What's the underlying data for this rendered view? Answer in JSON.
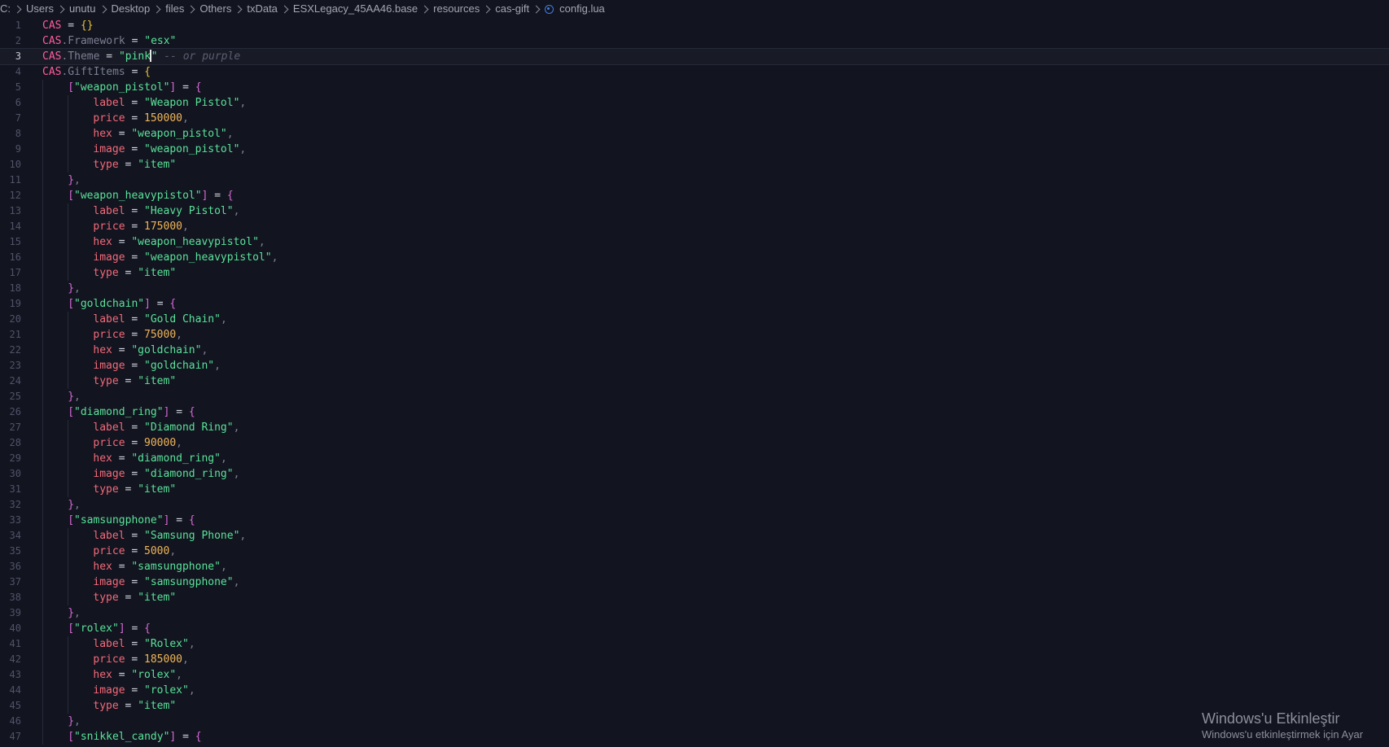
{
  "breadcrumb": {
    "segments": [
      "C:",
      "Users",
      "unutu",
      "Desktop",
      "files",
      "Others",
      "txData",
      "ESXLegacy_45AA46.base",
      "resources",
      "cas-gift"
    ],
    "file": "config.lua",
    "file_icon": "lua-file-icon"
  },
  "editor": {
    "current_line": 3,
    "colors": {
      "background": "#12141f",
      "keyword": "#ff5c9c",
      "string": "#59e39a",
      "number": "#f0b657",
      "field": "#f46a7a",
      "comment": "#5b5e72"
    },
    "lines": [
      {
        "n": "1",
        "indent": 0,
        "tokens": [
          [
            "kw-pink",
            "CAS"
          ],
          [
            "op",
            " = "
          ],
          [
            "brace",
            "{}"
          ]
        ]
      },
      {
        "n": "2",
        "indent": 0,
        "tokens": [
          [
            "kw-pink",
            "CAS"
          ],
          [
            "kw-prop",
            ".Framework"
          ],
          [
            "op",
            " = "
          ],
          [
            "str",
            "\"esx\""
          ]
        ]
      },
      {
        "n": "3",
        "indent": 0,
        "tokens": [
          [
            "kw-pink",
            "CAS"
          ],
          [
            "kw-prop",
            ".Theme"
          ],
          [
            "op",
            " = "
          ],
          [
            "str",
            "\"pink"
          ],
          [
            "cursor",
            ""
          ],
          [
            "str",
            "\""
          ],
          [
            "cmt",
            " -- or purple"
          ]
        ]
      },
      {
        "n": "4",
        "indent": 0,
        "tokens": [
          [
            "kw-pink",
            "CAS"
          ],
          [
            "kw-prop",
            ".GiftItems"
          ],
          [
            "op",
            " = "
          ],
          [
            "brace",
            "{"
          ]
        ]
      },
      {
        "n": "5",
        "indent": 1,
        "tokens": [
          [
            "brace2",
            "["
          ],
          [
            "str",
            "\"weapon_pistol\""
          ],
          [
            "brace2",
            "]"
          ],
          [
            "op",
            " = "
          ],
          [
            "brace2",
            "{"
          ]
        ]
      },
      {
        "n": "6",
        "indent": 2,
        "tokens": [
          [
            "key",
            "label"
          ],
          [
            "op",
            " = "
          ],
          [
            "str",
            "\"Weapon Pistol\""
          ],
          [
            "punc",
            ","
          ]
        ]
      },
      {
        "n": "7",
        "indent": 2,
        "tokens": [
          [
            "key",
            "price"
          ],
          [
            "op",
            " = "
          ],
          [
            "num",
            "150000"
          ],
          [
            "punc",
            ","
          ]
        ]
      },
      {
        "n": "8",
        "indent": 2,
        "tokens": [
          [
            "key",
            "hex"
          ],
          [
            "op",
            " = "
          ],
          [
            "str",
            "\"weapon_pistol\""
          ],
          [
            "punc",
            ","
          ]
        ]
      },
      {
        "n": "9",
        "indent": 2,
        "tokens": [
          [
            "key",
            "image"
          ],
          [
            "op",
            " = "
          ],
          [
            "str",
            "\"weapon_pistol\""
          ],
          [
            "punc",
            ","
          ]
        ]
      },
      {
        "n": "10",
        "indent": 2,
        "tokens": [
          [
            "key",
            "type"
          ],
          [
            "op",
            " = "
          ],
          [
            "str",
            "\"item\""
          ]
        ]
      },
      {
        "n": "11",
        "indent": 1,
        "tokens": [
          [
            "brace2",
            "}"
          ],
          [
            "punc",
            ","
          ]
        ]
      },
      {
        "n": "12",
        "indent": 1,
        "tokens": [
          [
            "brace2",
            "["
          ],
          [
            "str",
            "\"weapon_heavypistol\""
          ],
          [
            "brace2",
            "]"
          ],
          [
            "op",
            " = "
          ],
          [
            "brace2",
            "{"
          ]
        ]
      },
      {
        "n": "13",
        "indent": 2,
        "tokens": [
          [
            "key",
            "label"
          ],
          [
            "op",
            " = "
          ],
          [
            "str",
            "\"Heavy Pistol\""
          ],
          [
            "punc",
            ","
          ]
        ]
      },
      {
        "n": "14",
        "indent": 2,
        "tokens": [
          [
            "key",
            "price"
          ],
          [
            "op",
            " = "
          ],
          [
            "num",
            "175000"
          ],
          [
            "punc",
            ","
          ]
        ]
      },
      {
        "n": "15",
        "indent": 2,
        "tokens": [
          [
            "key",
            "hex"
          ],
          [
            "op",
            " = "
          ],
          [
            "str",
            "\"weapon_heavypistol\""
          ],
          [
            "punc",
            ","
          ]
        ]
      },
      {
        "n": "16",
        "indent": 2,
        "tokens": [
          [
            "key",
            "image"
          ],
          [
            "op",
            " = "
          ],
          [
            "str",
            "\"weapon_heavypistol\""
          ],
          [
            "punc",
            ","
          ]
        ]
      },
      {
        "n": "17",
        "indent": 2,
        "tokens": [
          [
            "key",
            "type"
          ],
          [
            "op",
            " = "
          ],
          [
            "str",
            "\"item\""
          ]
        ]
      },
      {
        "n": "18",
        "indent": 1,
        "tokens": [
          [
            "brace2",
            "}"
          ],
          [
            "punc",
            ","
          ]
        ]
      },
      {
        "n": "19",
        "indent": 1,
        "tokens": [
          [
            "brace2",
            "["
          ],
          [
            "str",
            "\"goldchain\""
          ],
          [
            "brace2",
            "]"
          ],
          [
            "op",
            " = "
          ],
          [
            "brace2",
            "{"
          ]
        ]
      },
      {
        "n": "20",
        "indent": 2,
        "tokens": [
          [
            "key",
            "label"
          ],
          [
            "op",
            " = "
          ],
          [
            "str",
            "\"Gold Chain\""
          ],
          [
            "punc",
            ","
          ]
        ]
      },
      {
        "n": "21",
        "indent": 2,
        "tokens": [
          [
            "key",
            "price"
          ],
          [
            "op",
            " = "
          ],
          [
            "num",
            "75000"
          ],
          [
            "punc",
            ","
          ]
        ]
      },
      {
        "n": "22",
        "indent": 2,
        "tokens": [
          [
            "key",
            "hex"
          ],
          [
            "op",
            " = "
          ],
          [
            "str",
            "\"goldchain\""
          ],
          [
            "punc",
            ","
          ]
        ]
      },
      {
        "n": "23",
        "indent": 2,
        "tokens": [
          [
            "key",
            "image"
          ],
          [
            "op",
            " = "
          ],
          [
            "str",
            "\"goldchain\""
          ],
          [
            "punc",
            ","
          ]
        ]
      },
      {
        "n": "24",
        "indent": 2,
        "tokens": [
          [
            "key",
            "type"
          ],
          [
            "op",
            " = "
          ],
          [
            "str",
            "\"item\""
          ]
        ]
      },
      {
        "n": "25",
        "indent": 1,
        "tokens": [
          [
            "brace2",
            "}"
          ],
          [
            "punc",
            ","
          ]
        ]
      },
      {
        "n": "26",
        "indent": 1,
        "tokens": [
          [
            "brace2",
            "["
          ],
          [
            "str",
            "\"diamond_ring\""
          ],
          [
            "brace2",
            "]"
          ],
          [
            "op",
            " = "
          ],
          [
            "brace2",
            "{"
          ]
        ]
      },
      {
        "n": "27",
        "indent": 2,
        "tokens": [
          [
            "key",
            "label"
          ],
          [
            "op",
            " = "
          ],
          [
            "str",
            "\"Diamond Ring\""
          ],
          [
            "punc",
            ","
          ]
        ]
      },
      {
        "n": "28",
        "indent": 2,
        "tokens": [
          [
            "key",
            "price"
          ],
          [
            "op",
            " = "
          ],
          [
            "num",
            "90000"
          ],
          [
            "punc",
            ","
          ]
        ]
      },
      {
        "n": "29",
        "indent": 2,
        "tokens": [
          [
            "key",
            "hex"
          ],
          [
            "op",
            " = "
          ],
          [
            "str",
            "\"diamond_ring\""
          ],
          [
            "punc",
            ","
          ]
        ]
      },
      {
        "n": "30",
        "indent": 2,
        "tokens": [
          [
            "key",
            "image"
          ],
          [
            "op",
            " = "
          ],
          [
            "str",
            "\"diamond_ring\""
          ],
          [
            "punc",
            ","
          ]
        ]
      },
      {
        "n": "31",
        "indent": 2,
        "tokens": [
          [
            "key",
            "type"
          ],
          [
            "op",
            " = "
          ],
          [
            "str",
            "\"item\""
          ]
        ]
      },
      {
        "n": "32",
        "indent": 1,
        "tokens": [
          [
            "brace2",
            "}"
          ],
          [
            "punc",
            ","
          ]
        ]
      },
      {
        "n": "33",
        "indent": 1,
        "tokens": [
          [
            "brace2",
            "["
          ],
          [
            "str",
            "\"samsungphone\""
          ],
          [
            "brace2",
            "]"
          ],
          [
            "op",
            " = "
          ],
          [
            "brace2",
            "{"
          ]
        ]
      },
      {
        "n": "34",
        "indent": 2,
        "tokens": [
          [
            "key",
            "label"
          ],
          [
            "op",
            " = "
          ],
          [
            "str",
            "\"Samsung Phone\""
          ],
          [
            "punc",
            ","
          ]
        ]
      },
      {
        "n": "35",
        "indent": 2,
        "tokens": [
          [
            "key",
            "price"
          ],
          [
            "op",
            " = "
          ],
          [
            "num",
            "5000"
          ],
          [
            "punc",
            ","
          ]
        ]
      },
      {
        "n": "36",
        "indent": 2,
        "tokens": [
          [
            "key",
            "hex"
          ],
          [
            "op",
            " = "
          ],
          [
            "str",
            "\"samsungphone\""
          ],
          [
            "punc",
            ","
          ]
        ]
      },
      {
        "n": "37",
        "indent": 2,
        "tokens": [
          [
            "key",
            "image"
          ],
          [
            "op",
            " = "
          ],
          [
            "str",
            "\"samsungphone\""
          ],
          [
            "punc",
            ","
          ]
        ]
      },
      {
        "n": "38",
        "indent": 2,
        "tokens": [
          [
            "key",
            "type"
          ],
          [
            "op",
            " = "
          ],
          [
            "str",
            "\"item\""
          ]
        ]
      },
      {
        "n": "39",
        "indent": 1,
        "tokens": [
          [
            "brace2",
            "}"
          ],
          [
            "punc",
            ","
          ]
        ]
      },
      {
        "n": "40",
        "indent": 1,
        "tokens": [
          [
            "brace2",
            "["
          ],
          [
            "str",
            "\"rolex\""
          ],
          [
            "brace2",
            "]"
          ],
          [
            "op",
            " = "
          ],
          [
            "brace2",
            "{"
          ]
        ]
      },
      {
        "n": "41",
        "indent": 2,
        "tokens": [
          [
            "key",
            "label"
          ],
          [
            "op",
            " = "
          ],
          [
            "str",
            "\"Rolex\""
          ],
          [
            "punc",
            ","
          ]
        ]
      },
      {
        "n": "42",
        "indent": 2,
        "tokens": [
          [
            "key",
            "price"
          ],
          [
            "op",
            " = "
          ],
          [
            "num",
            "185000"
          ],
          [
            "punc",
            ","
          ]
        ]
      },
      {
        "n": "43",
        "indent": 2,
        "tokens": [
          [
            "key",
            "hex"
          ],
          [
            "op",
            " = "
          ],
          [
            "str",
            "\"rolex\""
          ],
          [
            "punc",
            ","
          ]
        ]
      },
      {
        "n": "44",
        "indent": 2,
        "tokens": [
          [
            "key",
            "image"
          ],
          [
            "op",
            " = "
          ],
          [
            "str",
            "\"rolex\""
          ],
          [
            "punc",
            ","
          ]
        ]
      },
      {
        "n": "45",
        "indent": 2,
        "tokens": [
          [
            "key",
            "type"
          ],
          [
            "op",
            " = "
          ],
          [
            "str",
            "\"item\""
          ]
        ]
      },
      {
        "n": "46",
        "indent": 1,
        "tokens": [
          [
            "brace2",
            "}"
          ],
          [
            "punc",
            ","
          ]
        ]
      },
      {
        "n": "47",
        "indent": 1,
        "tokens": [
          [
            "brace2",
            "["
          ],
          [
            "str",
            "\"snikkel_candy\""
          ],
          [
            "brace2",
            "]"
          ],
          [
            "op",
            " = "
          ],
          [
            "brace2",
            "{"
          ]
        ]
      }
    ]
  },
  "watermark": {
    "title": "Windows'u Etkinleştir",
    "subtitle": "Windows'u etkinleştirmek için Ayar"
  }
}
